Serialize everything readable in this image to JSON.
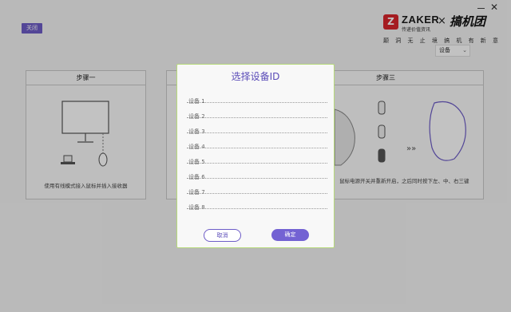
{
  "header": {
    "top_button": "关闭"
  },
  "brand": {
    "logo_letter": "Z",
    "name": "ZAKER",
    "sub": "传递价值资讯",
    "x": "×",
    "partner": "搞机团",
    "slogan": "颠 洞 无 止 境   搞 机 有 新 意"
  },
  "device_select": {
    "value": "设备",
    "chevron": "⌄"
  },
  "steps": [
    {
      "title": "步骤一",
      "desc": "使用有线模式接入鼠标并插入接收器"
    },
    {
      "title": ""
    },
    {
      "title": "步骤三",
      "desc": "鼠标电源开关并重新开启，之后同时按下左、中、右三键"
    }
  ],
  "modal": {
    "title": "选择设备ID",
    "devices": [
      "设备 1",
      "设备 2",
      "设备 3",
      "设备 4",
      "设备 5",
      "设备 6",
      "设备 7",
      "设备 8"
    ],
    "cancel_label": "取消",
    "ok_label": "确定"
  },
  "colors": {
    "accent": "#6d5cc7",
    "modal_border": "#b6d97a",
    "brand_red": "#d9262c"
  }
}
